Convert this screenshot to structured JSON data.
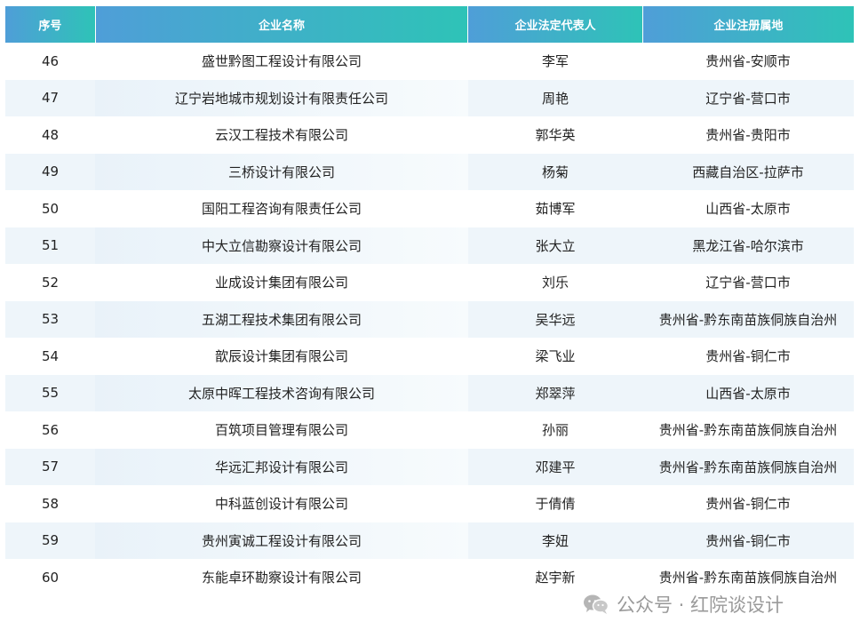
{
  "table": {
    "headers": [
      "序号",
      "企业名称",
      "企业法定代表人",
      "企业注册属地"
    ],
    "rows": [
      [
        "46",
        "盛世黔图工程设计有限公司",
        "李军",
        "贵州省-安顺市"
      ],
      [
        "47",
        "辽宁岩地城市规划设计有限责任公司",
        "周艳",
        "辽宁省-营口市"
      ],
      [
        "48",
        "云汉工程技术有限公司",
        "郭华英",
        "贵州省-贵阳市"
      ],
      [
        "49",
        "三桥设计有限公司",
        "杨菊",
        "西藏自治区-拉萨市"
      ],
      [
        "50",
        "国阳工程咨询有限责任公司",
        "茹博军",
        "山西省-太原市"
      ],
      [
        "51",
        "中大立信勘察设计有限公司",
        "张大立",
        "黑龙江省-哈尔滨市"
      ],
      [
        "52",
        "业成设计集团有限公司",
        "刘乐",
        "辽宁省-营口市"
      ],
      [
        "53",
        "五湖工程技术集团有限公司",
        "吴华远",
        "贵州省-黔东南苗族侗族自治州"
      ],
      [
        "54",
        "歆辰设计集团有限公司",
        "梁飞业",
        "贵州省-铜仁市"
      ],
      [
        "55",
        "太原中晖工程技术咨询有限公司",
        "郑翠萍",
        "山西省-太原市"
      ],
      [
        "56",
        "百筑项目管理有限公司",
        "孙丽",
        "贵州省-黔东南苗族侗族自治州"
      ],
      [
        "57",
        "华远汇邦设计有限公司",
        "邓建平",
        "贵州省-黔东南苗族侗族自治州"
      ],
      [
        "58",
        "中科蓝创设计有限公司",
        "于倩倩",
        "贵州省-铜仁市"
      ],
      [
        "59",
        "贵州寅诚工程设计有限公司",
        "李妞",
        "贵州省-铜仁市"
      ],
      [
        "60",
        "东能卓环勘察设计有限公司",
        "赵宇新",
        "贵州省-黔东南苗族侗族自治州"
      ]
    ]
  },
  "watermark": {
    "text": "公众号 · 红院谈设计",
    "icon": "wechat-icon"
  }
}
